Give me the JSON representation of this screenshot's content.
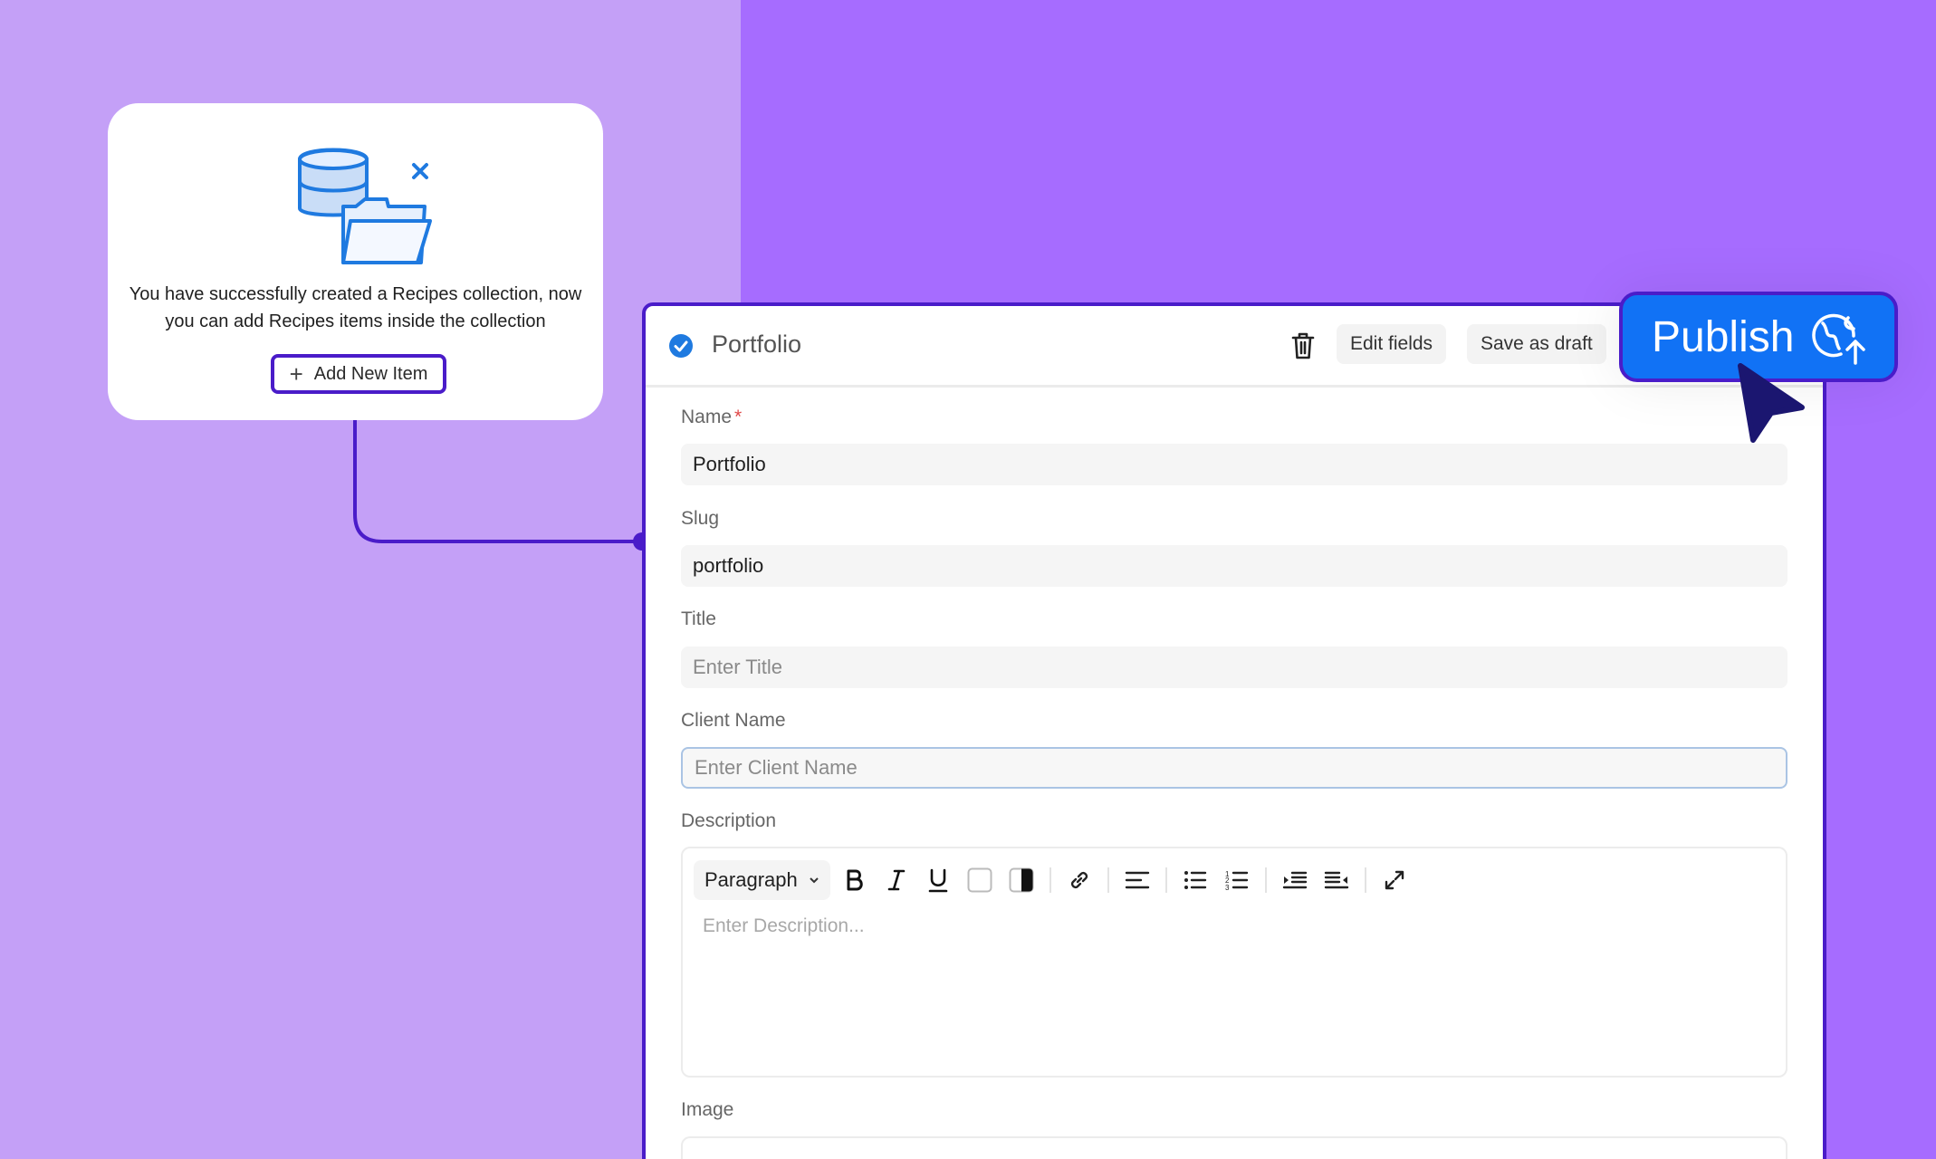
{
  "colors": {
    "background_left": "#c4a0f7",
    "background_right": "#a66cff",
    "accent_outline": "#4a1cc9",
    "publish_blue": "#1172f5",
    "illustration_blue": "#1f7ae0",
    "required_red": "#e04848"
  },
  "success_card": {
    "illustration_icon": "database-folder-illustration",
    "message": "You have successfully created a Recipes collection, now you can add Recipes items inside the collection",
    "add_button_icon": "plus-icon",
    "add_button_label": "Add New Item"
  },
  "editor": {
    "status_icon": "check-circle-icon",
    "title": "Portfolio",
    "delete_icon": "trash-icon",
    "edit_fields_label": "Edit fields",
    "save_draft_label": "Save as draft",
    "fields": {
      "name": {
        "label": "Name",
        "required_mark": "*",
        "value": "Portfolio"
      },
      "slug": {
        "label": "Slug",
        "value": "portfolio"
      },
      "title": {
        "label": "Title",
        "placeholder": "Enter Title"
      },
      "client_name": {
        "label": "Client Name",
        "placeholder": "Enter Client Name"
      },
      "description": {
        "label": "Description",
        "block_format": "Paragraph",
        "placeholder": "Enter Description..."
      },
      "image": {
        "label": "Image"
      }
    },
    "toolbar_icons": [
      "bold-icon",
      "italic-icon",
      "underline-icon",
      "text-color-icon",
      "highlight-color-icon",
      "link-icon",
      "align-left-icon",
      "bullet-list-icon",
      "numbered-list-icon",
      "outdent-icon",
      "indent-icon",
      "fullscreen-icon"
    ]
  },
  "publish": {
    "label": "Publish",
    "icon": "globe-upload-icon",
    "cursor_icon": "mouse-pointer-icon"
  }
}
